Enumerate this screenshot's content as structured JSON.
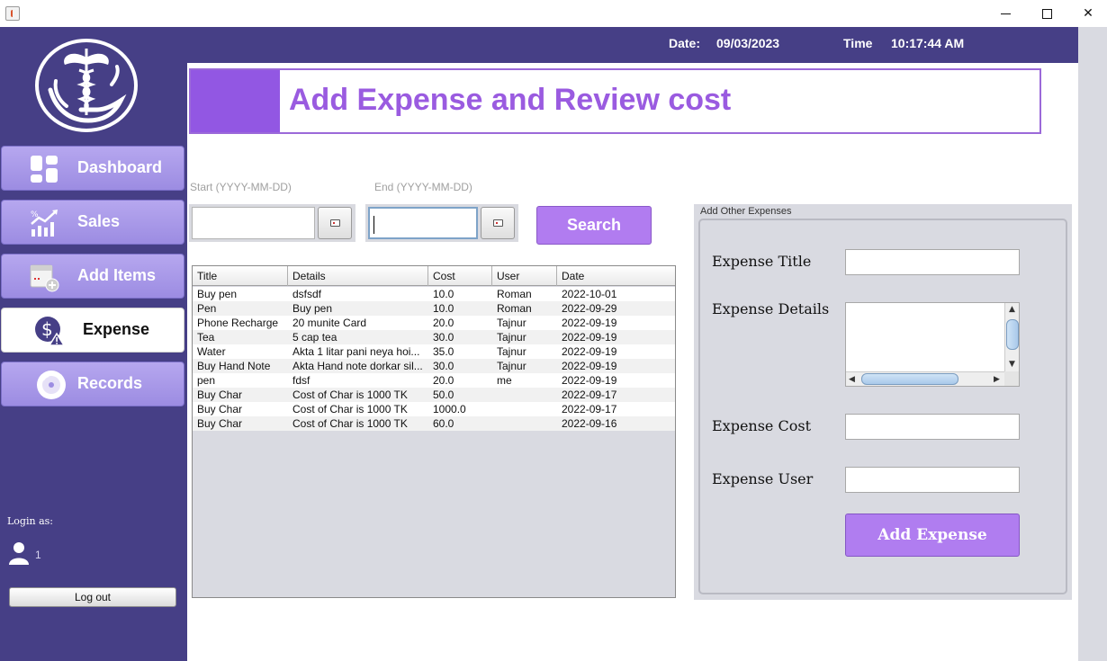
{
  "window": {
    "icon": "java-icon",
    "minimize": "minimize",
    "maximize": "maximize",
    "close": "✕"
  },
  "topbar": {
    "date_label": "Date:",
    "date_value": "09/03/2023",
    "time_label": "Time",
    "time_value": "10:17:44 AM"
  },
  "sidebar": {
    "logo": "medical-caduceus-logo",
    "items": [
      {
        "label": "Dashboard",
        "icon": "dashboard-icon"
      },
      {
        "label": "Sales",
        "icon": "sales-chart-icon"
      },
      {
        "label": "Add Items",
        "icon": "add-items-icon"
      },
      {
        "label": "Expense",
        "icon": "expense-dollar-icon",
        "active": true
      },
      {
        "label": "Records",
        "icon": "records-disc-icon"
      }
    ],
    "login_label": "Login as:",
    "user_name": "1",
    "logout_label": "Log out"
  },
  "header": {
    "title": "Add Expense and Review cost"
  },
  "filters": {
    "start_hint": "Start (YYYY-MM-DD)",
    "end_hint": "End (YYYY-MM-DD)",
    "start_value": "",
    "end_value": "",
    "search_label": "Search"
  },
  "table": {
    "columns": [
      "Title",
      "Details",
      "Cost",
      "User",
      "Date"
    ],
    "rows": [
      [
        "Buy pen",
        "dsfsdf",
        "10.0",
        "Roman",
        "2022-10-01"
      ],
      [
        "Pen",
        "Buy pen",
        "10.0",
        "Roman",
        "2022-09-29"
      ],
      [
        "Phone Recharge",
        "20 munite Card",
        "20.0",
        "Tajnur",
        "2022-09-19"
      ],
      [
        "Tea",
        "5 cap tea",
        "30.0",
        "Tajnur",
        "2022-09-19"
      ],
      [
        "Water",
        "Akta 1 litar pani neya hoi...",
        "35.0",
        "Tajnur",
        "2022-09-19"
      ],
      [
        "Buy Hand Note",
        "Akta Hand note dorkar sil...",
        "30.0",
        "Tajnur",
        "2022-09-19"
      ],
      [
        "pen",
        "fdsf",
        "20.0",
        "me",
        "2022-09-19"
      ],
      [
        "Buy Char",
        "Cost of Char is 1000 TK",
        "50.0",
        "",
        "2022-09-17"
      ],
      [
        "Buy Char",
        "Cost of Char is 1000 TK",
        "1000.0",
        "",
        "2022-09-17"
      ],
      [
        "Buy Char",
        "Cost of Char is 1000 TK",
        "60.0",
        "",
        "2022-09-16"
      ]
    ]
  },
  "panel": {
    "legend": "Add Other Expenses",
    "title_label": "Expense Title",
    "details_label": "Expense Details",
    "cost_label": "Expense Cost",
    "user_label": "Expense User",
    "title_value": "",
    "details_value": "",
    "cost_value": "",
    "user_value": "",
    "submit_label": "Add Expense"
  },
  "colors": {
    "sidebar": "#463f86",
    "accent": "#9a5be0",
    "button": "#b17cf0"
  }
}
